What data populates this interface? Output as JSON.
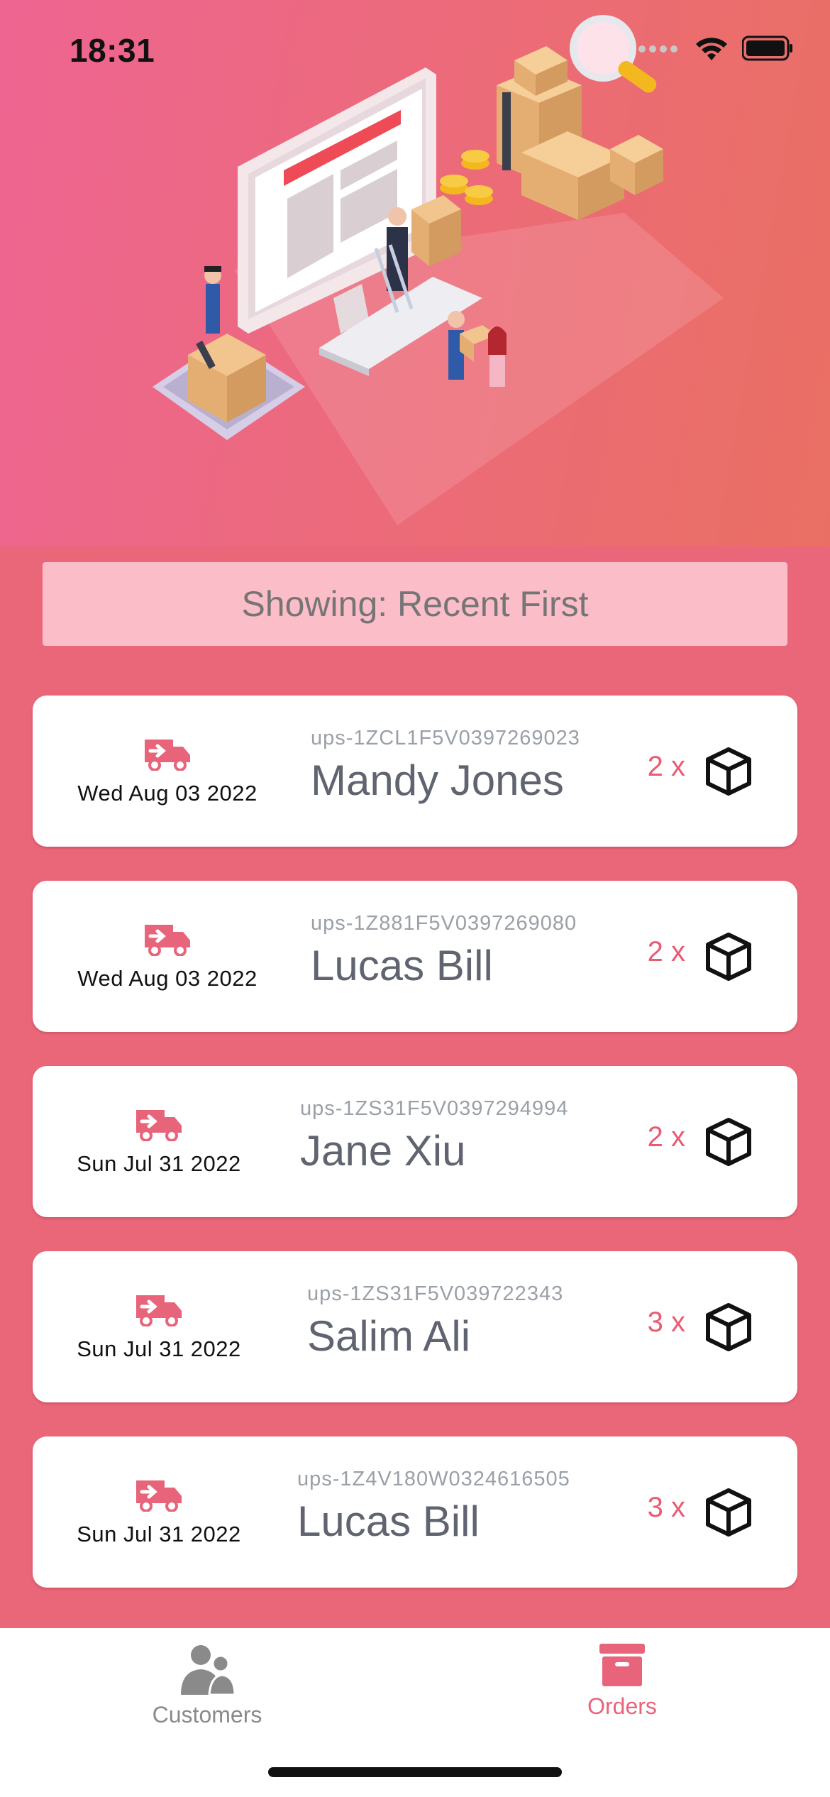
{
  "status": {
    "time": "18:31"
  },
  "sort": {
    "label": "Showing: Recent First"
  },
  "orders": [
    {
      "date": "Wed Aug 03 2022",
      "tracking": "ups-1ZCL1F5V0397269023",
      "name": "Mandy Jones",
      "qty": "2 x"
    },
    {
      "date": "Wed Aug 03 2022",
      "tracking": "ups-1Z881F5V0397269080",
      "name": "Lucas Bill",
      "qty": "2 x"
    },
    {
      "date": "Sun Jul 31 2022",
      "tracking": "ups-1ZS31F5V0397294994",
      "name": "Jane Xiu",
      "qty": "2 x"
    },
    {
      "date": "Sun Jul 31 2022",
      "tracking": "ups-1ZS31F5V039722343",
      "name": "Salim Ali",
      "qty": "3 x"
    },
    {
      "date": "Sun Jul 31 2022",
      "tracking": "ups-1Z4V180W0324616505",
      "name": "Lucas Bill",
      "qty": "3 x"
    }
  ],
  "tabs": [
    {
      "label": "Customers",
      "icon": "customers-icon",
      "active": false
    },
    {
      "label": "Orders",
      "icon": "archive-box-icon",
      "active": true
    }
  ],
  "colors": {
    "accent": "#ea5a72",
    "background": "#ea6679",
    "banner": "#fbbdc8"
  }
}
